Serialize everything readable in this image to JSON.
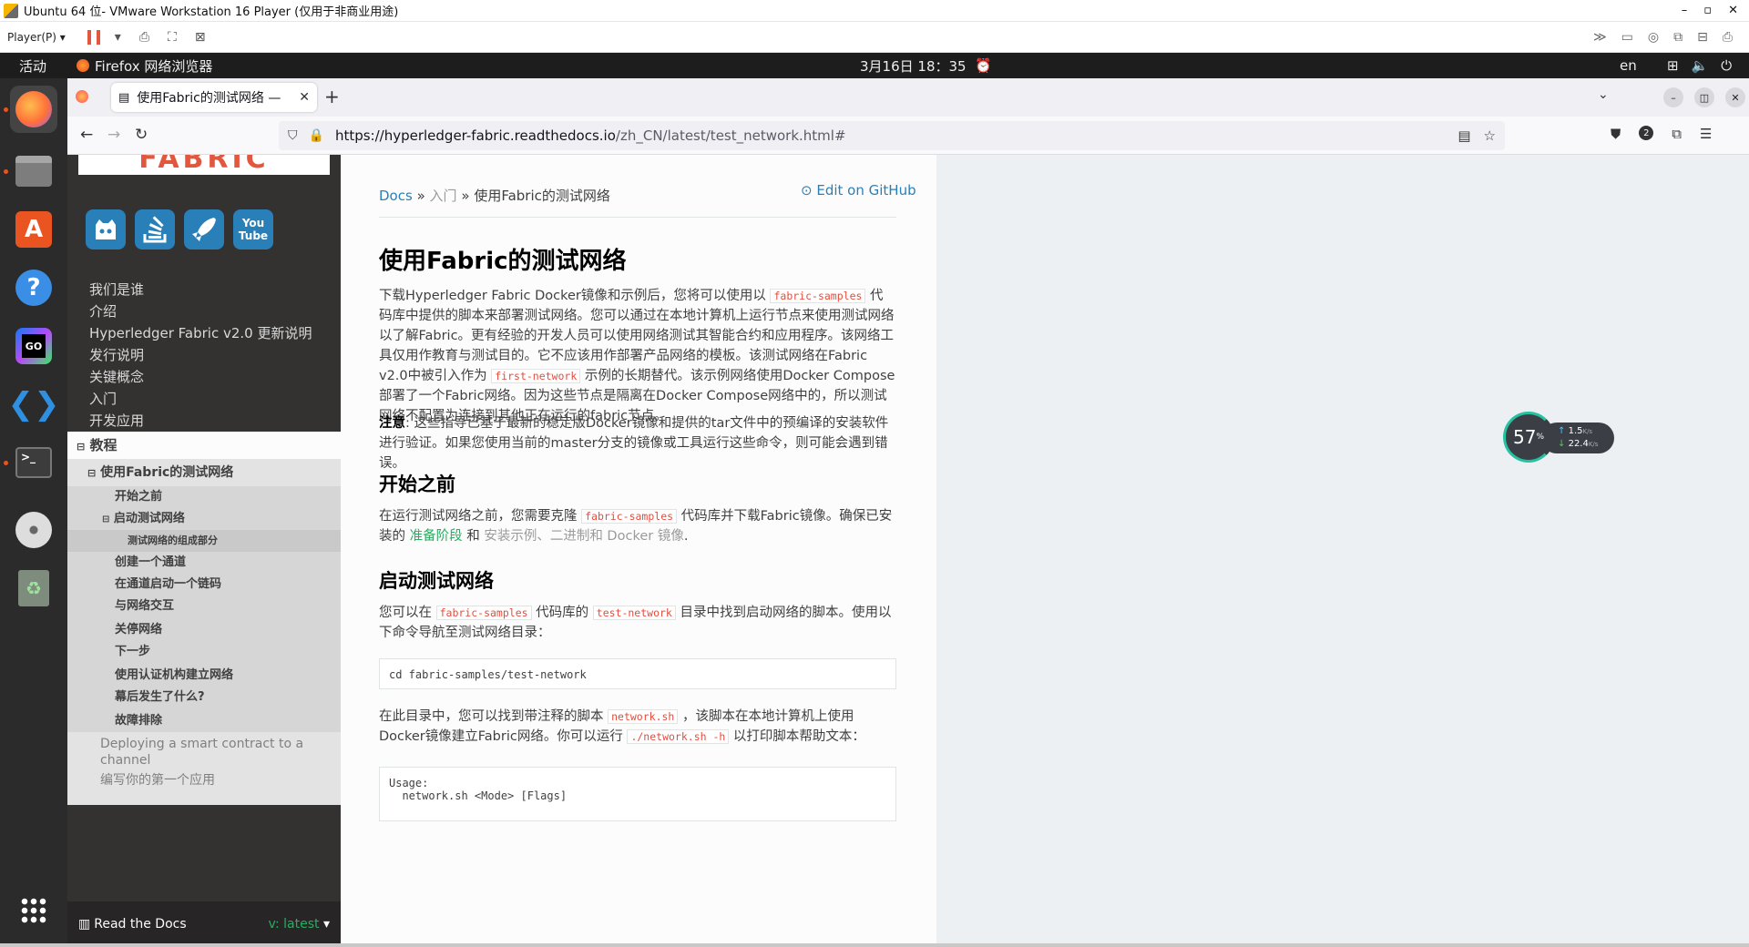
{
  "vm": {
    "title": "Ubuntu 64 位- VMware Workstation 16 Player (仅用于非商业用途)",
    "player_label": "Player(P)",
    "ctrl_min": "–",
    "ctrl_max": "▫",
    "ctrl_close": "✕"
  },
  "topbar": {
    "activities": "活动",
    "app_name": "Firefox 网络浏览器",
    "clock": "3月16日  18：35",
    "lang": "en"
  },
  "dock": {
    "items": [
      "firefox-icon",
      "files-icon",
      "app-center-icon",
      "help-icon",
      "goland-icon",
      "vscode-icon",
      "terminal-icon",
      "dvd-icon",
      "trash-icon",
      "show-apps-icon"
    ]
  },
  "browser": {
    "tab_title": "使用Fabric的测试网络 —",
    "url_host": "https://hyperledger-fabric.readthedocs.io",
    "url_path": "/zh_CN/latest/test_network.html#",
    "badge_count": "2"
  },
  "sidebar": {
    "logo_text": "FABRIC",
    "social": [
      {
        "name": "github",
        "label": ""
      },
      {
        "name": "stackoverflow",
        "label": ""
      },
      {
        "name": "rocket",
        "label": ""
      },
      {
        "name": "youtube",
        "label": "You Tube"
      }
    ],
    "top_items": [
      "我们是谁",
      "介绍",
      "Hyperledger Fabric v2.0 更新说明",
      "发行说明",
      "关键概念",
      "入门",
      "开发应用"
    ],
    "current": "教程",
    "l2_current": "使用Fabric的测试网络",
    "l3_items_a": [
      "开始之前"
    ],
    "l3_expanded": "启动测试网络",
    "l4_items": [
      "测试网络的组成部分"
    ],
    "l3_items_b": [
      "创建一个通道",
      "在通道启动一个链码",
      "与网络交互",
      "关停网络",
      "下一步",
      "使用认证机构建立网络",
      "幕后发生了什么?",
      "故障排除"
    ],
    "l2_more": [
      "Deploying a smart contract to a channel",
      "编写你的第一个应用"
    ],
    "footer_label": "Read the Docs",
    "footer_version": "v: latest"
  },
  "content": {
    "breadcrumb_docs": "Docs",
    "breadcrumb_sep": "»",
    "breadcrumb_mid": "入门",
    "breadcrumb_current": "使用Fabric的测试网络",
    "edit_github": "Edit on GitHub",
    "title": "使用Fabric的测试网络",
    "p1": {
      "t1": "下载Hyperledger Fabric Docker镜像和示例后，您将可以使用以 ",
      "c1": "fabric-samples",
      "t2": " 代码库中提供的脚本来部署测试网络。您可以通过在本地计算机上运行节点来使用测试网络以了解Fabric。更有经验的开发人员可以使用网络测试其智能合约和应用程序。该网络工具仅用作教育与测试目的。它不应该用作部署产品网络的模板。该测试网络在Fabric v2.0中被引入作为 ",
      "c2": "first-network",
      "t3": " 示例的长期替代。该示例网络使用Docker Compose部署了一个Fabric网络。因为这些节点是隔离在Docker Compose网络中的，所以测试网络不配置为连接到其他正在运行的fabric节点。"
    },
    "note": {
      "label": "注意",
      "text": ": 这些指导已基于最新的稳定版Docker镜像和提供的tar文件中的预编译的安装软件进行验证。如果您使用当前的master分支的镜像或工具运行这些命令，则可能会遇到错误。"
    },
    "h_before": "开始之前",
    "p2": {
      "t1": "在运行测试网络之前，您需要克隆 ",
      "c1": "fabric-samples",
      "t2": " 代码库并下载Fabric镜像。确保已安装的 ",
      "l1": "准备阶段",
      "t3": " 和 ",
      "l2": "安装示例、二进制和 Docker 镜像",
      "t4": "."
    },
    "h_start": "启动测试网络",
    "p3": {
      "t1": "您可以在 ",
      "c1": "fabric-samples",
      "t2": " 代码库的 ",
      "c2": "test-network",
      "t3": " 目录中找到启动网络的脚本。使用以下命令导航至测试网络目录："
    },
    "code1": "cd fabric-samples/test-network",
    "p4": {
      "t1": "在此目录中，您可以找到带注释的脚本 ",
      "c1": "network.sh",
      "t2": " ，该脚本在本地计算机上使用Docker镜像建立Fabric网络。你可以运行 ",
      "c2": "./network.sh -h",
      "t3": " 以打印脚本帮助文本："
    },
    "code2": "Usage:\n  network.sh <Mode> [Flags]"
  },
  "netwidget": {
    "percent": "57",
    "percent_unit": "%",
    "up": "1.5",
    "up_unit": "K/s",
    "down": "22.4",
    "down_unit": "K/s"
  }
}
